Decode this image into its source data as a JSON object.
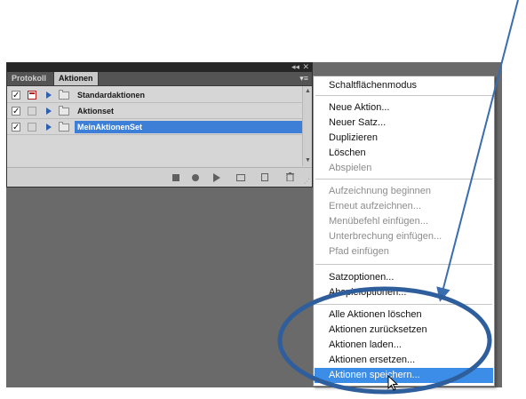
{
  "panel": {
    "tabs": [
      "Protokoll",
      "Aktionen"
    ],
    "collapse_glyph": "◂◂",
    "close_glyph": "✕",
    "menu_glyph": "▾≡",
    "rows": [
      {
        "name": "Standardaktionen",
        "checked": true,
        "dialog_active": true,
        "selected": false
      },
      {
        "name": "Aktionset",
        "checked": true,
        "dialog_active": false,
        "selected": false
      },
      {
        "name": "MeinAktionenSet",
        "checked": true,
        "dialog_active": false,
        "selected": true
      }
    ],
    "check_glyph": "✓",
    "footer_icons": [
      "stop-icon",
      "record-icon",
      "play-icon",
      "new-set-icon",
      "new-action-icon",
      "trash-icon"
    ],
    "trash_glyph": "🗑"
  },
  "menu": {
    "items": [
      {
        "label": "Schaltflächenmodus",
        "disabled": false
      },
      {
        "label": "Neue Aktion...",
        "disabled": false
      },
      {
        "label": "Neuer Satz...",
        "disabled": false
      },
      {
        "label": "Duplizieren",
        "disabled": false
      },
      {
        "label": "Löschen",
        "disabled": false
      },
      {
        "label": "Abspielen",
        "disabled": true
      },
      {
        "label": "Aufzeichnung beginnen",
        "disabled": true
      },
      {
        "label": "Erneut aufzeichnen...",
        "disabled": true
      },
      {
        "label": "Menübefehl einfügen...",
        "disabled": true
      },
      {
        "label": "Unterbrechung einfügen...",
        "disabled": true
      },
      {
        "label": "Pfad einfügen",
        "disabled": true
      },
      {
        "label": "Satzoptionen...",
        "disabled": false
      },
      {
        "label": "Abspieloptionen...",
        "disabled": false
      },
      {
        "label": "Alle Aktionen löschen",
        "disabled": false
      },
      {
        "label": "Aktionen zurücksetzen",
        "disabled": false
      },
      {
        "label": "Aktionen laden...",
        "disabled": false
      },
      {
        "label": "Aktionen ersetzen...",
        "disabled": false
      },
      {
        "label": "Aktionen speichern...",
        "disabled": false,
        "highlighted": true
      }
    ]
  },
  "colors": {
    "selection": "#3d7fd6",
    "menu_highlight": "#3b8de8",
    "annotation": "#2f5e9c"
  }
}
